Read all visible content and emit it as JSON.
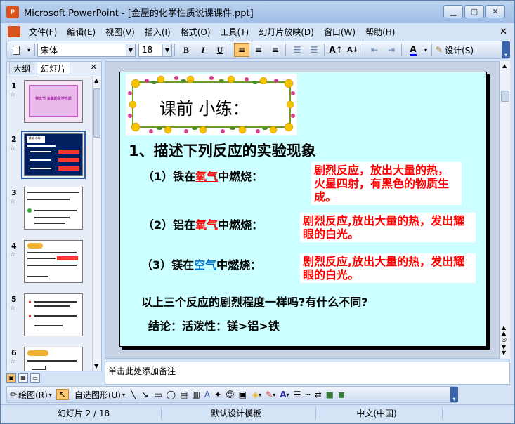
{
  "window": {
    "title": "Microsoft PowerPoint - [金屋的化学性质说课课件.ppt]",
    "app_icon": "P"
  },
  "menu": [
    "文件(F)",
    "编辑(E)",
    "视图(V)",
    "插入(I)",
    "格式(O)",
    "工具(T)",
    "幻灯片放映(D)",
    "窗口(W)",
    "帮助(H)"
  ],
  "toolbar": {
    "font_name": "宋体",
    "font_size": "18",
    "bold": "B",
    "italic": "I",
    "underline": "U",
    "design_label": "设计(S)"
  },
  "left_pane": {
    "tabs": [
      "大纲",
      "幻灯片"
    ],
    "active_tab": "幻灯片",
    "slides": [
      {
        "num": "1",
        "title": "第五节 金属的化学性质"
      },
      {
        "num": "2",
        "title": "课前 小练："
      },
      {
        "num": "3"
      },
      {
        "num": "4"
      },
      {
        "num": "5"
      },
      {
        "num": "6"
      }
    ],
    "selected": "2"
  },
  "slide": {
    "banner": "课前 小练：",
    "heading": "1、描述下列反应的实验现象",
    "items": [
      {
        "prefix": "（1）铁在",
        "gas": "氧气",
        "suffix": "中燃烧：",
        "answer": "剧烈反应，放出大量的热，火星四射，有黑色的物质生成。"
      },
      {
        "prefix": "（2）铝在",
        "gas": "氧气",
        "suffix": "中燃烧：",
        "answer": "剧烈反应,放出大量的热，发出耀眼的白光。"
      },
      {
        "prefix": "（3）镁在",
        "gas": "空气",
        "suffix": "中燃烧：",
        "answer": "剧烈反应,放出大量的热，发出耀眼的白光。"
      }
    ],
    "question": "以上三个反应的剧烈程度一样吗?有什么不同?",
    "conclusion": "结论：活泼性：镁>铝>铁"
  },
  "notes_placeholder": "单击此处添加备注",
  "drawbar": {
    "draw_label": "绘图(R)",
    "autoshape_label": "自选图形(U)"
  },
  "status": {
    "slide_pos": "幻灯片 2 / 18",
    "template": "默认设计模板",
    "language": "中文(中国)"
  },
  "colors": {
    "slide_bg": "#ccffff",
    "answer_red": "#ff0000",
    "gas_red": "#ff0000",
    "gas_blue_underline": "#ff0000"
  }
}
